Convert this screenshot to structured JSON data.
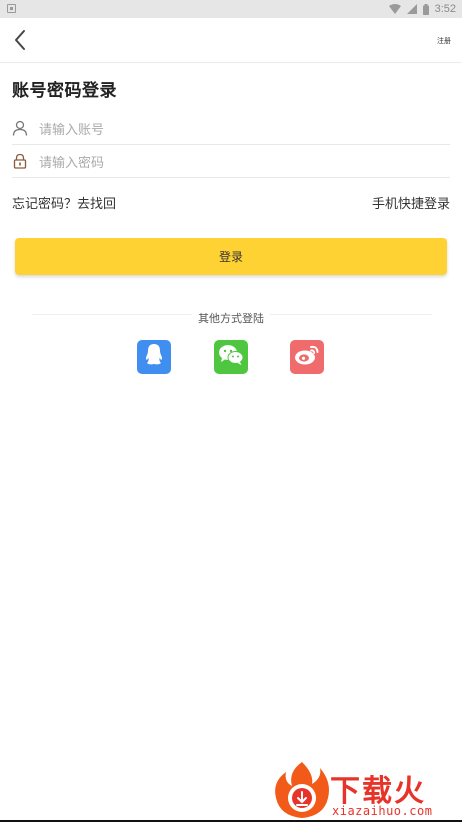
{
  "status_bar": {
    "time": "3:52"
  },
  "header": {
    "register_label": "注册"
  },
  "title": "账号密码登录",
  "account": {
    "placeholder": "请输入账号",
    "value": ""
  },
  "password": {
    "placeholder": "请输入密码",
    "value": ""
  },
  "links": {
    "forgot": "忘记密码？去找回",
    "quick_login": "手机快捷登录"
  },
  "login_button": "登录",
  "other_methods": {
    "label": "其他方式登陆",
    "items": [
      "qq-icon",
      "wechat-icon",
      "weibo-icon"
    ]
  },
  "colors": {
    "accent": "#ffd233",
    "qq": "#3f8ef0",
    "wechat": "#4fc640",
    "weibo": "#f06b6b"
  },
  "watermark": {
    "text": "下载火",
    "sub": "xiazaihuo.com"
  }
}
